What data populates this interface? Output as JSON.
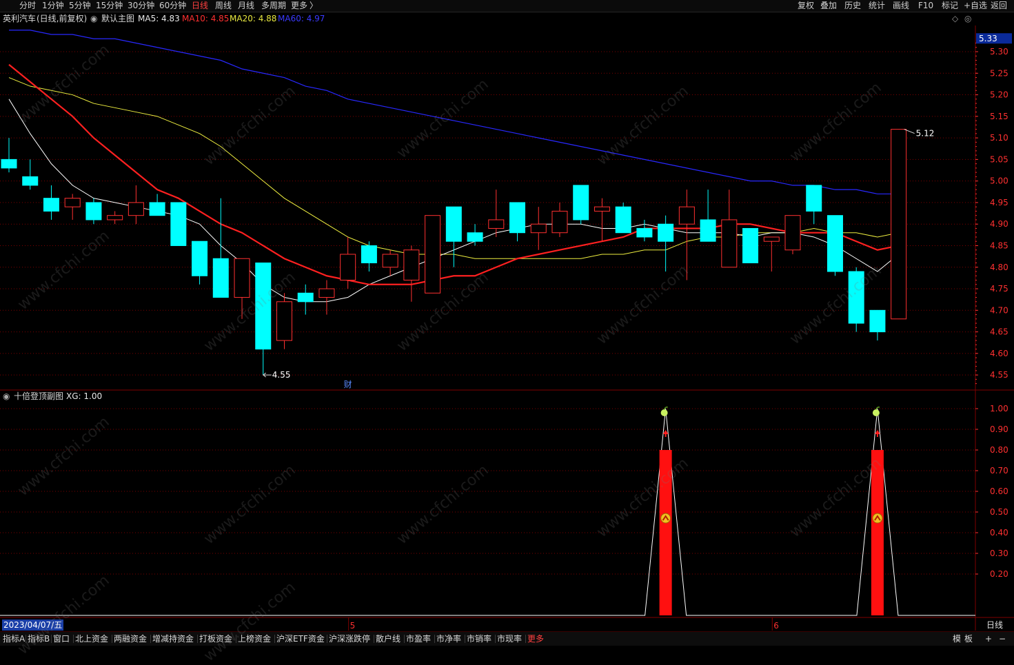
{
  "topbar": {
    "left": [
      "分时",
      "1分钟",
      "5分钟",
      "15分钟",
      "30分钟",
      "60分钟",
      "日线",
      "周线",
      "月线",
      "多周期",
      "更多"
    ],
    "active": "日线",
    "right": [
      "复权",
      "叠加",
      "历史",
      "统计",
      "画线",
      "F10",
      "标记",
      "+自选",
      "返回"
    ]
  },
  "info": {
    "stock": "英利汽车",
    "params": "(日线,前复权)",
    "template": "默认主图",
    "ma5": "MA5: 4.83",
    "ma10": "MA10: 4.85",
    "ma20": "MA20: 4.88",
    "ma60": "MA60: 4.97"
  },
  "sub": {
    "title": "十倍登顶副图",
    "xg": "XG: 1.00"
  },
  "bottombar": {
    "items": [
      "指标A",
      "指标B",
      "窗口",
      "北上资金",
      "两融资金",
      "增减持资金",
      "打板资金",
      "上榜资金",
      "沪深ETF资金",
      "沪深涨跌停",
      "散户线",
      "市盈率",
      "市净率",
      "市销率",
      "市现率",
      "更多"
    ],
    "active": "更多",
    "right": [
      "模",
      "板",
      "+",
      "−"
    ]
  },
  "date_label": "2023/04/07/五",
  "period_label": "日线",
  "watermark": "www.cfchi.com",
  "colors": {
    "up": "#ff3030",
    "down": "#00ffff",
    "ma5": "#ffffff",
    "ma10": "#ff2020",
    "ma20": "#f0f040",
    "ma60": "#2828ff",
    "grid": "#800000",
    "axis_text": "#ff3030"
  },
  "chart_data": [
    {
      "type": "candlestick",
      "axis_ticks": [
        5.3,
        5.25,
        5.2,
        5.15,
        5.1,
        5.05,
        5.0,
        4.95,
        4.9,
        4.85,
        4.8,
        4.75,
        4.7,
        4.65,
        4.6,
        4.55
      ],
      "ylim": [
        4.52,
        5.36
      ],
      "last_price_label": "5.33",
      "annotations": {
        "high": "5.12",
        "low": "4.55",
        "marker": "财"
      },
      "month_labels": [
        "5",
        "6"
      ],
      "candles": [
        {
          "o": 5.05,
          "h": 5.1,
          "l": 5.02,
          "c": 5.03
        },
        {
          "o": 5.01,
          "h": 5.05,
          "l": 4.98,
          "c": 4.99
        },
        {
          "o": 4.96,
          "h": 4.99,
          "l": 4.91,
          "c": 4.93
        },
        {
          "o": 4.94,
          "h": 4.97,
          "l": 4.91,
          "c": 4.96
        },
        {
          "o": 4.95,
          "h": 4.96,
          "l": 4.9,
          "c": 4.91
        },
        {
          "o": 4.91,
          "h": 4.93,
          "l": 4.9,
          "c": 4.92
        },
        {
          "o": 4.92,
          "h": 4.99,
          "l": 4.9,
          "c": 4.95
        },
        {
          "o": 4.95,
          "h": 4.97,
          "l": 4.92,
          "c": 4.92
        },
        {
          "o": 4.95,
          "h": 4.95,
          "l": 4.85,
          "c": 4.85
        },
        {
          "o": 4.86,
          "h": 4.86,
          "l": 4.76,
          "c": 4.78
        },
        {
          "o": 4.82,
          "h": 4.96,
          "l": 4.76,
          "c": 4.73
        },
        {
          "o": 4.73,
          "h": 4.82,
          "l": 4.68,
          "c": 4.82
        },
        {
          "o": 4.81,
          "h": 4.81,
          "l": 4.55,
          "c": 4.61
        },
        {
          "o": 4.63,
          "h": 4.74,
          "l": 4.61,
          "c": 4.72
        },
        {
          "o": 4.74,
          "h": 4.76,
          "l": 4.69,
          "c": 4.72
        },
        {
          "o": 4.73,
          "h": 4.77,
          "l": 4.69,
          "c": 4.75
        },
        {
          "o": 4.77,
          "h": 4.87,
          "l": 4.75,
          "c": 4.83
        },
        {
          "o": 4.85,
          "h": 4.86,
          "l": 4.79,
          "c": 4.81
        },
        {
          "o": 4.8,
          "h": 4.84,
          "l": 4.78,
          "c": 4.83
        },
        {
          "o": 4.77,
          "h": 4.85,
          "l": 4.72,
          "c": 4.84
        },
        {
          "o": 4.74,
          "h": 4.92,
          "l": 4.74,
          "c": 4.92
        },
        {
          "o": 4.94,
          "h": 4.94,
          "l": 4.8,
          "c": 4.86
        },
        {
          "o": 4.88,
          "h": 4.9,
          "l": 4.85,
          "c": 4.86
        },
        {
          "o": 4.89,
          "h": 4.98,
          "l": 4.87,
          "c": 4.91
        },
        {
          "o": 4.95,
          "h": 4.95,
          "l": 4.86,
          "c": 4.88
        },
        {
          "o": 4.88,
          "h": 4.94,
          "l": 4.84,
          "c": 4.9
        },
        {
          "o": 4.88,
          "h": 4.95,
          "l": 4.87,
          "c": 4.93
        },
        {
          "o": 4.99,
          "h": 4.99,
          "l": 4.9,
          "c": 4.91
        },
        {
          "o": 4.93,
          "h": 4.96,
          "l": 4.86,
          "c": 4.94
        },
        {
          "o": 4.94,
          "h": 4.95,
          "l": 4.88,
          "c": 4.88
        },
        {
          "o": 4.89,
          "h": 4.91,
          "l": 4.86,
          "c": 4.87
        },
        {
          "o": 4.9,
          "h": 4.92,
          "l": 4.79,
          "c": 4.86
        },
        {
          "o": 4.9,
          "h": 4.98,
          "l": 4.77,
          "c": 4.94
        },
        {
          "o": 4.91,
          "h": 4.98,
          "l": 4.86,
          "c": 4.86
        },
        {
          "o": 4.8,
          "h": 4.98,
          "l": 4.8,
          "c": 4.91
        },
        {
          "o": 4.89,
          "h": 4.89,
          "l": 4.81,
          "c": 4.81
        },
        {
          "o": 4.86,
          "h": 4.87,
          "l": 4.79,
          "c": 4.87
        },
        {
          "o": 4.84,
          "h": 4.92,
          "l": 4.83,
          "c": 4.92
        },
        {
          "o": 4.99,
          "h": 4.99,
          "l": 4.9,
          "c": 4.93
        },
        {
          "o": 4.92,
          "h": 4.92,
          "l": 4.78,
          "c": 4.79
        },
        {
          "o": 4.79,
          "h": 4.8,
          "l": 4.65,
          "c": 4.67
        },
        {
          "o": 4.7,
          "h": 4.7,
          "l": 4.63,
          "c": 4.65
        },
        {
          "o": 4.68,
          "h": 5.12,
          "l": 4.68,
          "c": 5.12
        }
      ],
      "ma5": [
        5.19,
        5.11,
        5.04,
        4.99,
        4.96,
        4.95,
        4.94,
        4.93,
        4.92,
        4.9,
        4.85,
        4.81,
        4.76,
        4.73,
        4.72,
        4.72,
        4.73,
        4.76,
        4.78,
        4.8,
        4.82,
        4.84,
        4.86,
        4.88,
        4.89,
        4.9,
        4.9,
        4.9,
        4.89,
        4.89,
        4.9,
        4.89,
        4.88,
        4.88,
        4.88,
        4.87,
        4.88,
        4.88,
        4.87,
        4.85,
        4.82,
        4.79,
        4.83
      ],
      "ma10": [
        5.27,
        5.23,
        5.19,
        5.15,
        5.1,
        5.06,
        5.02,
        4.98,
        4.96,
        4.93,
        4.9,
        4.88,
        4.85,
        4.82,
        4.8,
        4.78,
        4.77,
        4.76,
        4.76,
        4.76,
        4.77,
        4.78,
        4.78,
        4.8,
        4.82,
        4.83,
        4.84,
        4.85,
        4.86,
        4.87,
        4.89,
        4.89,
        4.89,
        4.89,
        4.9,
        4.9,
        4.89,
        4.88,
        4.88,
        4.88,
        4.86,
        4.84,
        4.85
      ],
      "ma20": [
        5.24,
        5.22,
        5.21,
        5.2,
        5.18,
        5.17,
        5.16,
        5.15,
        5.13,
        5.11,
        5.08,
        5.04,
        5.0,
        4.96,
        4.93,
        4.9,
        4.87,
        4.85,
        4.84,
        4.83,
        4.83,
        4.83,
        4.82,
        4.82,
        4.82,
        4.82,
        4.82,
        4.82,
        4.83,
        4.83,
        4.84,
        4.84,
        4.86,
        4.87,
        4.87,
        4.88,
        4.88,
        4.88,
        4.89,
        4.88,
        4.88,
        4.87,
        4.88
      ],
      "ma60": [
        5.35,
        5.35,
        5.34,
        5.34,
        5.33,
        5.33,
        5.32,
        5.31,
        5.3,
        5.29,
        5.28,
        5.26,
        5.25,
        5.24,
        5.22,
        5.21,
        5.19,
        5.18,
        5.17,
        5.16,
        5.15,
        5.14,
        5.13,
        5.12,
        5.11,
        5.1,
        5.09,
        5.08,
        5.07,
        5.06,
        5.05,
        5.04,
        5.03,
        5.02,
        5.01,
        5.0,
        5.0,
        4.99,
        4.99,
        4.98,
        4.98,
        4.97,
        4.97
      ]
    },
    {
      "type": "indicator",
      "axis_ticks": [
        1.0,
        0.9,
        0.8,
        0.7,
        0.6,
        0.5,
        0.4,
        0.3,
        0.2
      ],
      "ylim": [
        0,
        1.06
      ],
      "signal_bars": [
        {
          "index": 31,
          "value": 0.8
        },
        {
          "index": 41,
          "value": 0.8
        }
      ],
      "line_peaks": [
        31,
        41
      ],
      "line_peak_value": 1.0
    }
  ]
}
